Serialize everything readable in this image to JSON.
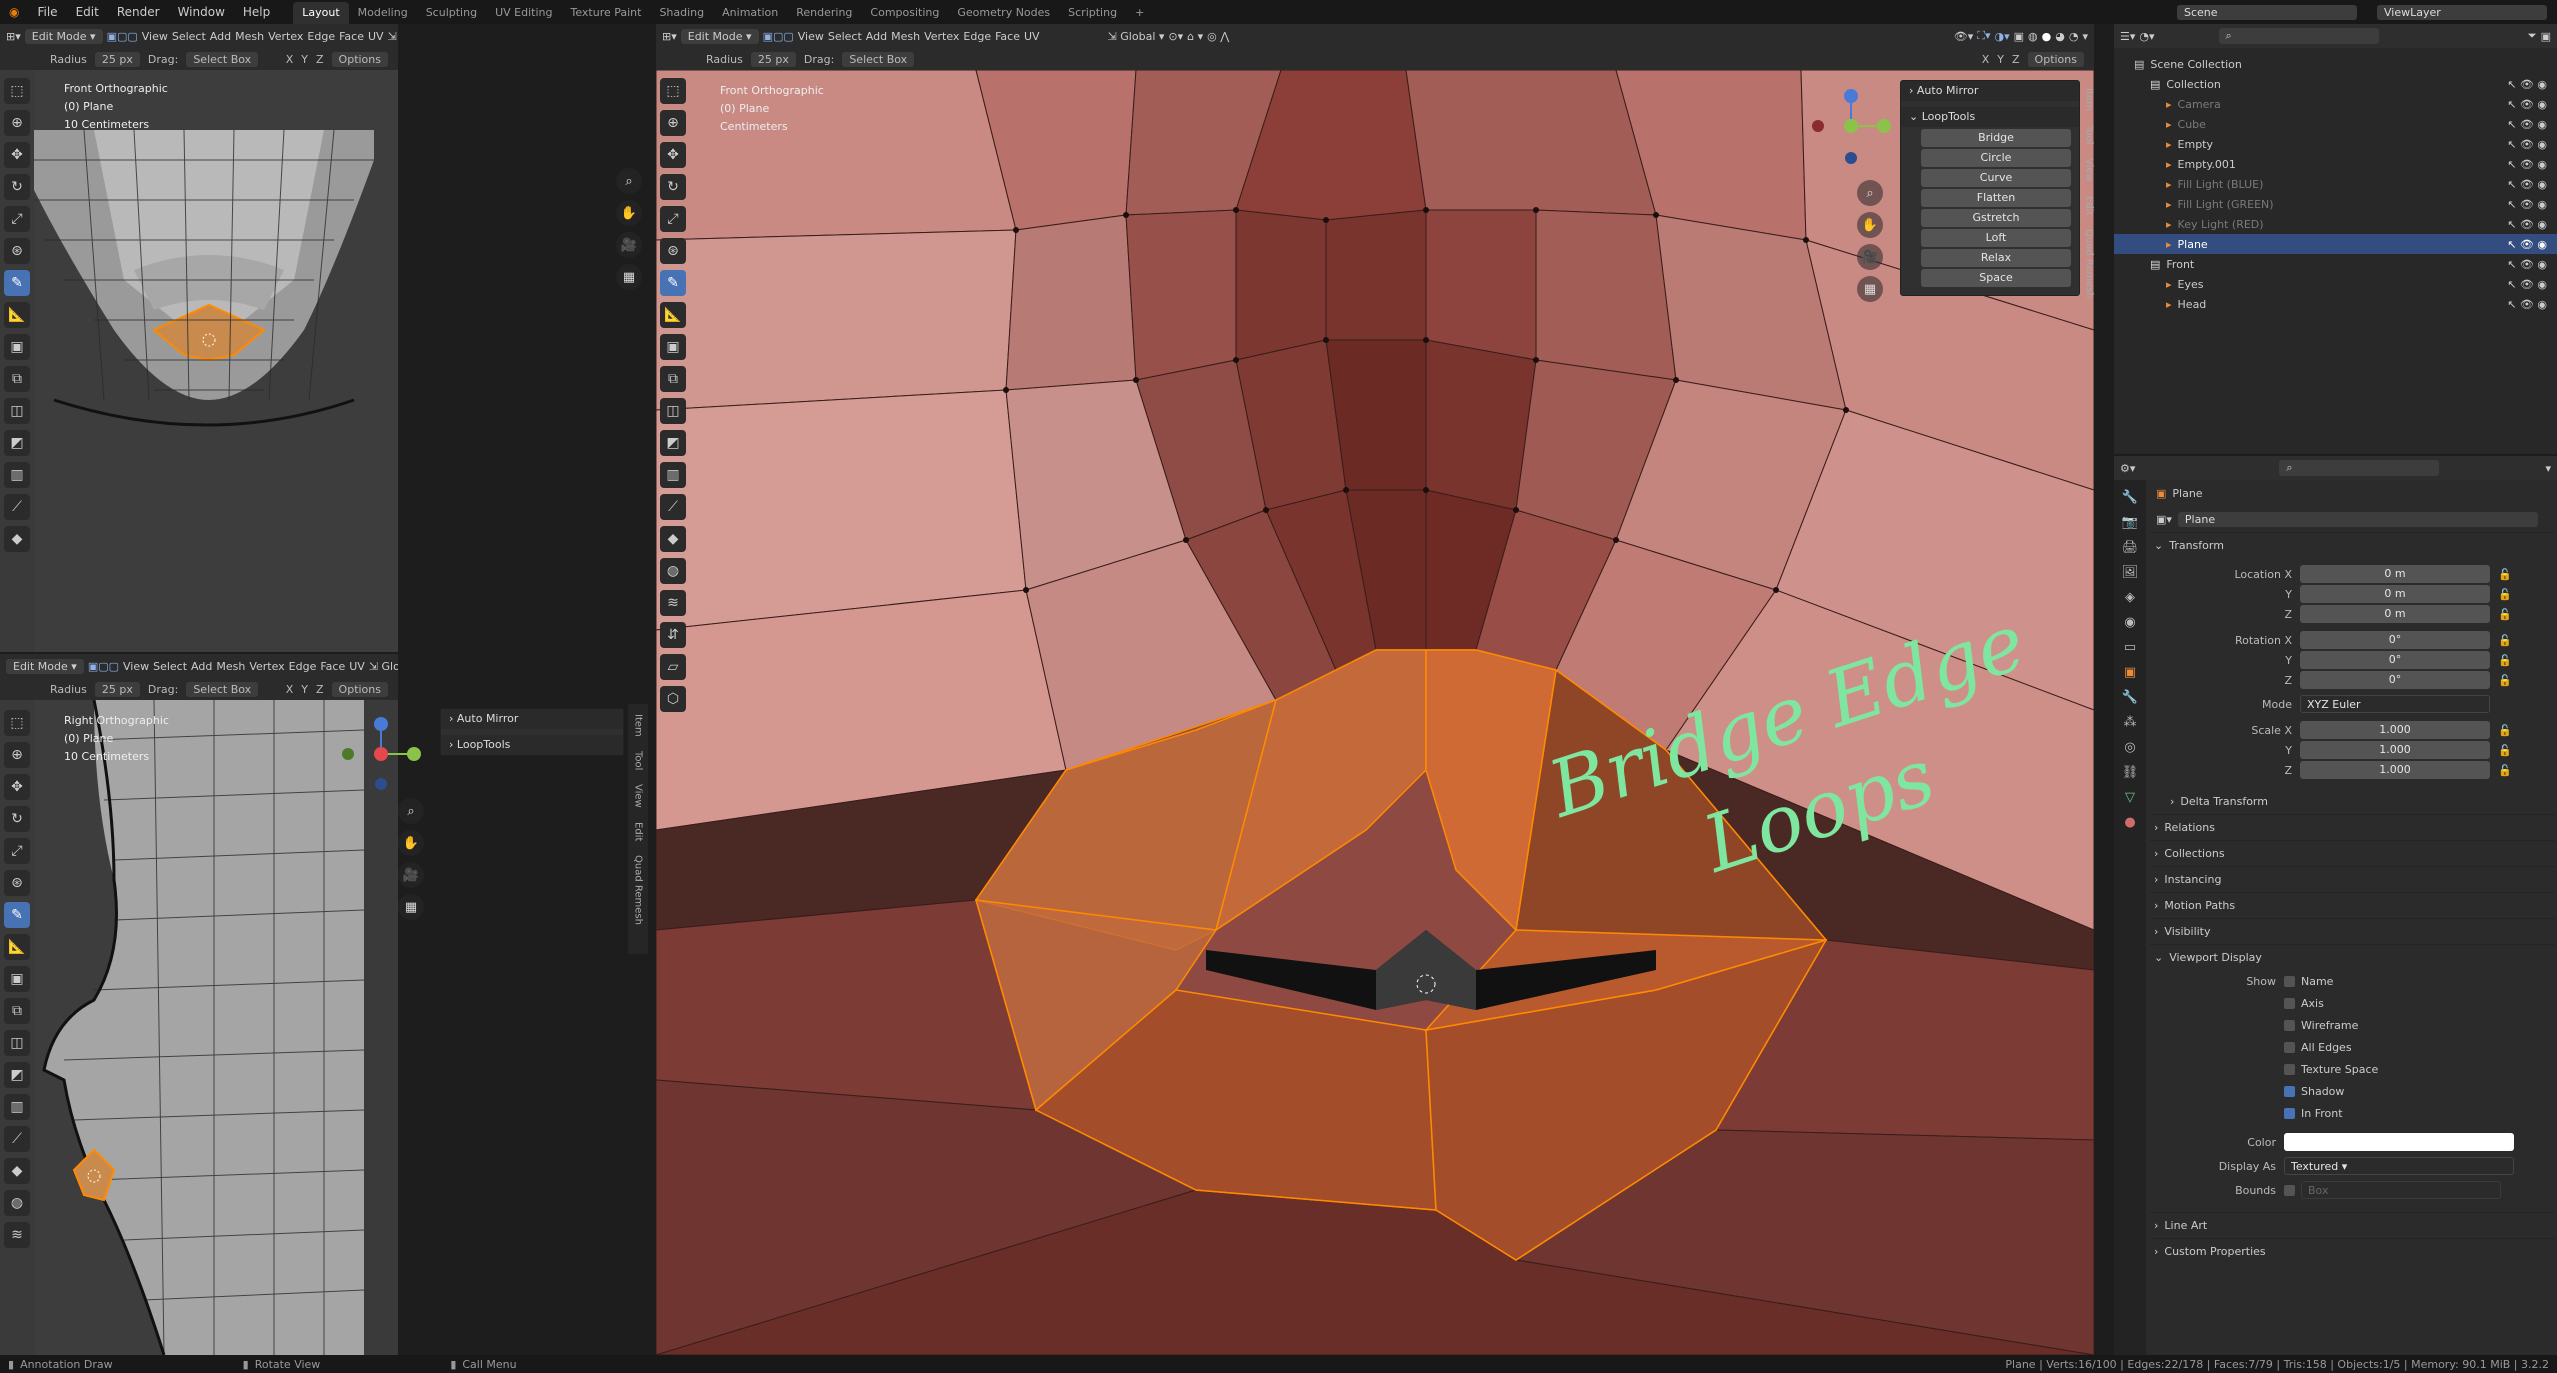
{
  "menu": {
    "items": [
      "File",
      "Edit",
      "Render",
      "Window",
      "Help"
    ],
    "workspaces": [
      "Layout",
      "Modeling",
      "Sculpting",
      "UV Editing",
      "Texture Paint",
      "Shading",
      "Animation",
      "Rendering",
      "Compositing",
      "Geometry Nodes",
      "Scripting"
    ],
    "add": "+",
    "scene": "Scene",
    "viewlayer": "ViewLayer"
  },
  "viewport_header": {
    "mode": "Edit Mode",
    "menus": [
      "View",
      "Select",
      "Add",
      "Mesh",
      "Vertex",
      "Edge",
      "Face",
      "UV"
    ],
    "orientation": "Global",
    "axes": [
      "X",
      "Y",
      "Z"
    ],
    "options": "Options"
  },
  "tool_settings": {
    "radius_label": "Radius",
    "radius_value": "25 px",
    "drag_label": "Drag:",
    "drag_value": "Select Box"
  },
  "vp_topleft": {
    "view": "Front Orthographic",
    "object": "(0) Plane",
    "scale": "10 Centimeters"
  },
  "vp_bottomleft": {
    "view": "Right Orthographic",
    "object": "(0) Plane",
    "scale": "10 Centimeters"
  },
  "vp_main": {
    "view": "Front Orthographic",
    "object": "(0) Plane",
    "scale": "Centimeters"
  },
  "npanel": {
    "auto_mirror": "Auto Mirror",
    "looptools": "LoopTools",
    "buttons": [
      "Bridge",
      "Circle",
      "Curve",
      "Flatten",
      "Gstretch",
      "Loft",
      "Relax",
      "Space"
    ],
    "tabs": [
      "Item",
      "Tool",
      "View",
      "Edit",
      "Quad Remesh"
    ]
  },
  "annotation": {
    "line1": "Bridge Edge",
    "line2": "Loops"
  },
  "outliner": {
    "root": "Scene Collection",
    "rows": [
      {
        "name": "Collection",
        "indent": 1,
        "dim": false,
        "sel": false
      },
      {
        "name": "Camera",
        "indent": 2,
        "dim": true,
        "sel": false
      },
      {
        "name": "Cube",
        "indent": 2,
        "dim": true,
        "sel": false
      },
      {
        "name": "Empty",
        "indent": 2,
        "dim": false,
        "sel": false
      },
      {
        "name": "Empty.001",
        "indent": 2,
        "dim": false,
        "sel": false
      },
      {
        "name": "Fill Light (BLUE)",
        "indent": 2,
        "dim": true,
        "sel": false
      },
      {
        "name": "Fill Light (GREEN)",
        "indent": 2,
        "dim": true,
        "sel": false
      },
      {
        "name": "Key Light (RED)",
        "indent": 2,
        "dim": true,
        "sel": false
      },
      {
        "name": "Plane",
        "indent": 2,
        "dim": false,
        "sel": true
      },
      {
        "name": "Front",
        "indent": 1,
        "dim": false,
        "sel": false
      },
      {
        "name": "Eyes",
        "indent": 2,
        "dim": false,
        "sel": false
      },
      {
        "name": "Head",
        "indent": 2,
        "dim": false,
        "sel": false
      }
    ]
  },
  "properties": {
    "object_name": "Plane",
    "data_name": "Plane",
    "transform": "Transform",
    "location": {
      "label": "Location X",
      "x": "0 m",
      "y": "0 m",
      "z": "0 m"
    },
    "rotation": {
      "label": "Rotation X",
      "x": "0°",
      "y": "0°",
      "z": "0°"
    },
    "mode_label": "Mode",
    "mode": "XYZ Euler",
    "scale": {
      "label": "Scale X",
      "x": "1.000",
      "y": "1.000",
      "z": "1.000"
    },
    "y": "Y",
    "z": "Z",
    "delta": "Delta Transform",
    "relations": "Relations",
    "collections": "Collections",
    "instancing": "Instancing",
    "motion_paths": "Motion Paths",
    "visibility": "Visibility",
    "viewport_display": "Viewport Display",
    "show_label": "Show",
    "show": [
      {
        "name": "Name",
        "on": false
      },
      {
        "name": "Axis",
        "on": false
      },
      {
        "name": "Wireframe",
        "on": false
      },
      {
        "name": "All Edges",
        "on": false
      },
      {
        "name": "Texture Space",
        "on": false
      },
      {
        "name": "Shadow",
        "on": true
      },
      {
        "name": "In Front",
        "on": true
      }
    ],
    "color_label": "Color",
    "display_as_label": "Display As",
    "display_as": "Textured",
    "bounds_label": "Bounds",
    "bounds_value": "Box",
    "line_art": "Line Art",
    "custom_props": "Custom Properties"
  },
  "status": {
    "left1": "Annotation Draw",
    "left2": "Rotate View",
    "left3": "Call Menu",
    "right": "Plane | Verts:16/100 | Edges:22/178 | Faces:7/79 | Tris:158 | Objects:1/5 | Memory: 90.1 MiB | 3.2.2"
  },
  "colors": {
    "accent": "#4772b3",
    "select": "#ff8a00",
    "mesh_main": "#9b4a40",
    "annotation": "#7fe6a0"
  }
}
